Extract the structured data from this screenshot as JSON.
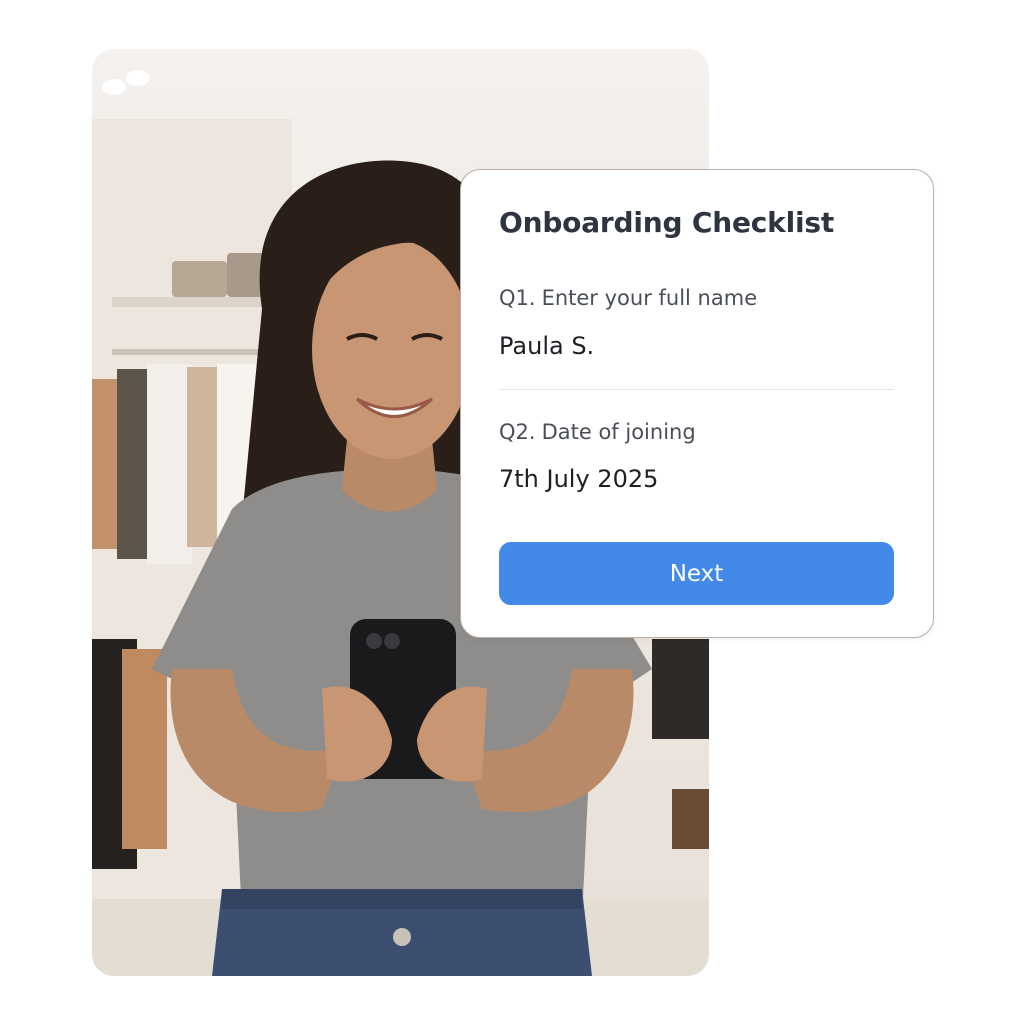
{
  "checklist": {
    "title": "Onboarding Checklist",
    "questions": [
      {
        "number": "Q1.",
        "label": "Enter your full name",
        "value": "Paula S."
      },
      {
        "number": "Q2.",
        "label": "Date of joining",
        "value": "7th July 2025"
      }
    ],
    "next_label": "Next"
  },
  "colors": {
    "accent": "#4289e8",
    "title": "#2e3440",
    "card_border": "#b9aea8"
  }
}
